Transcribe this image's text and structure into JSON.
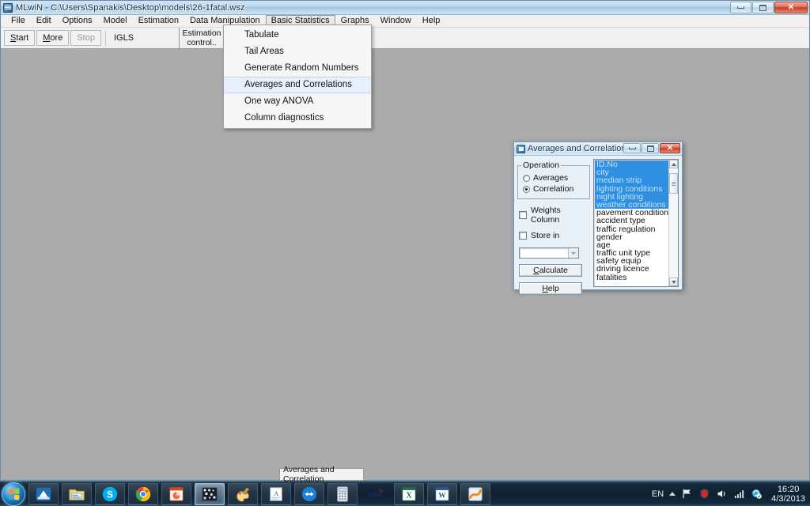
{
  "window": {
    "title": "MLwiN - C:\\Users\\Spanakis\\Desktop\\models\\26-1fatal.wsz",
    "icon": "mlwin-icon",
    "minimize_label": "–",
    "maximize_label": "❐",
    "close_label": "✕"
  },
  "menubar": {
    "items": [
      {
        "label": "File",
        "active": false
      },
      {
        "label": "Edit",
        "active": false
      },
      {
        "label": "Options",
        "active": false
      },
      {
        "label": "Model",
        "active": false
      },
      {
        "label": "Estimation",
        "active": false
      },
      {
        "label": "Data Manipulation",
        "active": false
      },
      {
        "label": "Basic Statistics",
        "active": true
      },
      {
        "label": "Graphs",
        "active": false
      },
      {
        "label": "Window",
        "active": false
      },
      {
        "label": "Help",
        "active": false
      }
    ]
  },
  "toolbar": {
    "start_label": "Start",
    "more_label": "More",
    "stop_label": "Stop",
    "method_label": "IGLS",
    "estimation_control_line1": "Estimation",
    "estimation_control_line2": "control.."
  },
  "dropdown": {
    "items": [
      {
        "label": "Tabulate",
        "highlighted": false
      },
      {
        "label": "Tail Areas",
        "highlighted": false
      },
      {
        "label": "Generate Random Numbers",
        "highlighted": false
      },
      {
        "label": "Averages and Correlations",
        "highlighted": true
      },
      {
        "label": "One way ANOVA",
        "highlighted": false
      },
      {
        "label": "Column diagnostics",
        "highlighted": false
      }
    ]
  },
  "dialog": {
    "title": "Averages and Correlation",
    "icon": "dialog-window-icon",
    "minimize_label": "–",
    "maximize_label": "❐",
    "close_label": "✕",
    "operation_group_label": "Operation",
    "radios": [
      {
        "label": "Averages",
        "checked": false
      },
      {
        "label": "Correlation",
        "checked": true
      }
    ],
    "checkboxes": [
      {
        "label": "Weights Column",
        "checked": false
      },
      {
        "label": "Store in",
        "checked": false
      }
    ],
    "combo_value": "",
    "calculate_button": "Calculate",
    "calculate_accel": "C",
    "help_button": "Help",
    "help_accel": "H",
    "variables": [
      {
        "name": "ID.No",
        "selected": true
      },
      {
        "name": "city",
        "selected": true
      },
      {
        "name": "median strip",
        "selected": true
      },
      {
        "name": "lighting conditions",
        "selected": true
      },
      {
        "name": "night lighting",
        "selected": true
      },
      {
        "name": "weather conditions",
        "selected": true
      },
      {
        "name": "pavement condition",
        "selected": false
      },
      {
        "name": "accident type",
        "selected": false
      },
      {
        "name": "traffic regulation",
        "selected": false
      },
      {
        "name": "gender",
        "selected": false
      },
      {
        "name": "age",
        "selected": false
      },
      {
        "name": "traffic unit type",
        "selected": false
      },
      {
        "name": "safety equip",
        "selected": false
      },
      {
        "name": "driving licence",
        "selected": false
      },
      {
        "name": "fatalities",
        "selected": false
      }
    ],
    "scroll_up_icon": "scroll-up-arrow-icon",
    "scroll_down_icon": "scroll-down-arrow-icon"
  },
  "task_window_button": {
    "label": "Averages and Correlation"
  },
  "taskbar": {
    "start_icon": "windows-start-orb-icon",
    "icons": [
      {
        "name": "maxthon-browser-icon",
        "active": false
      },
      {
        "name": "windows-explorer-icon",
        "active": false
      },
      {
        "name": "skype-icon",
        "active": false
      },
      {
        "name": "google-chrome-icon",
        "active": false
      },
      {
        "name": "powerpoint-icon",
        "active": false
      },
      {
        "name": "mlwin-icon",
        "active": true
      },
      {
        "name": "paint-icon",
        "active": false
      },
      {
        "name": "font-viewer-icon",
        "active": false
      },
      {
        "name": "teamviewer-icon",
        "active": false
      },
      {
        "name": "calculator-icon",
        "active": false
      },
      {
        "name": "viva-tv-icon",
        "active": false
      },
      {
        "name": "excel-icon",
        "active": false
      },
      {
        "name": "word-icon",
        "active": false
      },
      {
        "name": "foxit-reader-icon",
        "active": false
      }
    ],
    "tray": {
      "language": "EN",
      "show_hidden_icons": "show-hidden-icons-arrow",
      "action_center_icon": "flag-action-center-icon",
      "antivirus_icon": "antivirus-shield-icon",
      "volume_icon": "speaker-volume-icon",
      "network_icon": "network-signal-bars-icon",
      "sync_icon": "sync-status-icon",
      "time": "16:20",
      "date": "4/3/2013"
    }
  },
  "colors": {
    "workspace": "#ababab",
    "selection_blue": "#2f8fe0",
    "accent_titlebar": "#b7d5e9",
    "close_red": "#c63a22"
  }
}
